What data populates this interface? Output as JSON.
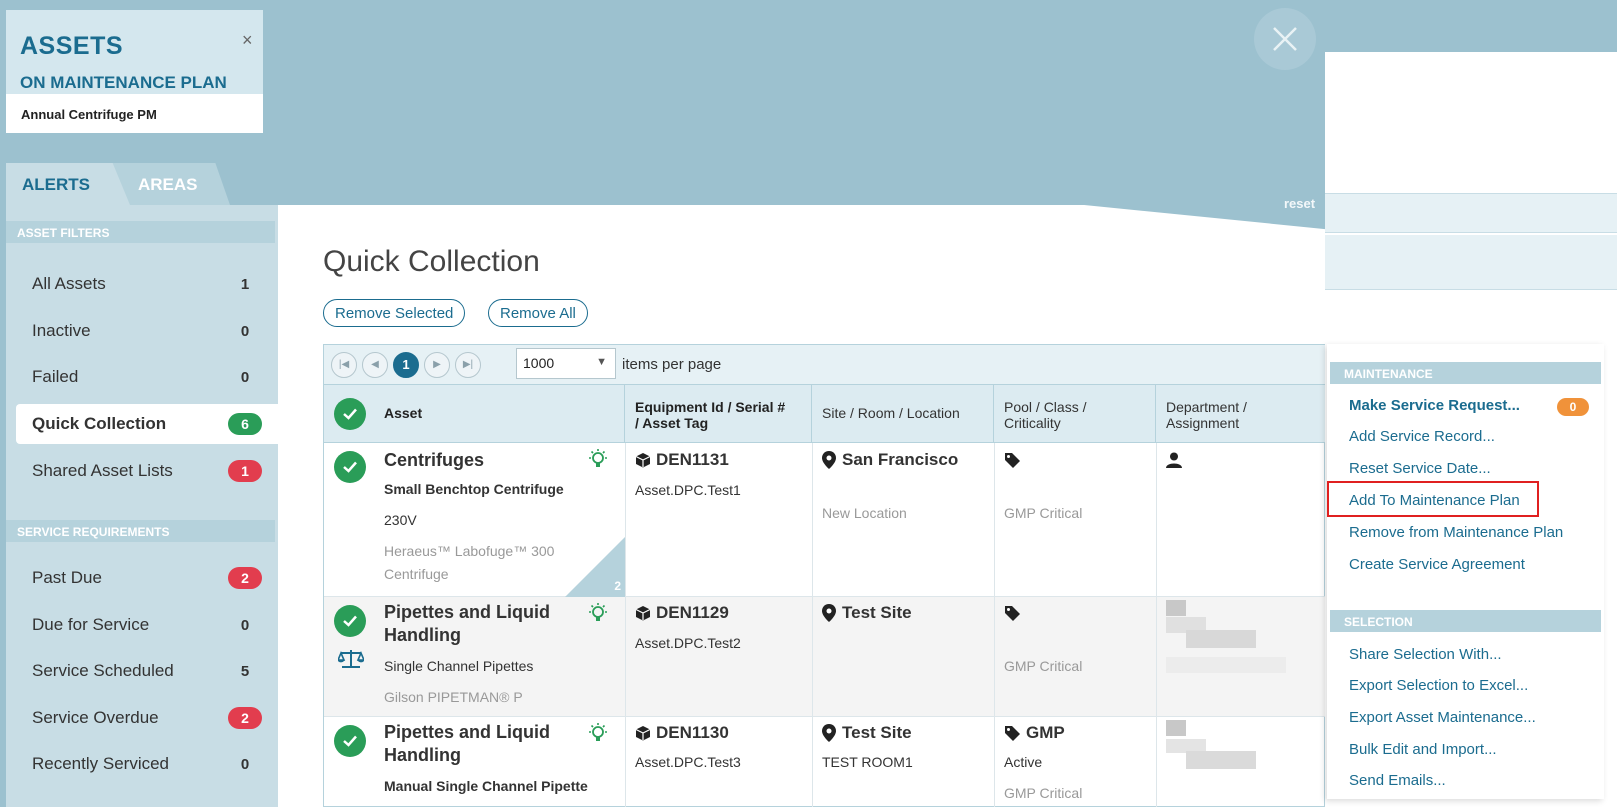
{
  "header": {
    "title": "ASSETS",
    "subtitle": "ON MAINTENANCE PLAN",
    "plan_name": "Annual Centrifuge PM",
    "close_glyph": "×"
  },
  "tabs": [
    {
      "label": "ALERTS",
      "active": true
    },
    {
      "label": "AREAS",
      "active": false
    }
  ],
  "reset_label": "reset",
  "sidebar": {
    "asset_filters_heading": "ASSET FILTERS",
    "asset_filters": [
      {
        "label": "All Assets",
        "count": "1"
      },
      {
        "label": "Inactive",
        "count": "0"
      },
      {
        "label": "Failed",
        "count": "0"
      },
      {
        "label": "Quick Collection",
        "count": "6",
        "active": true
      },
      {
        "label": "Shared Asset Lists",
        "count": "1"
      }
    ],
    "service_heading": "SERVICE REQUIREMENTS",
    "service_filters": [
      {
        "label": "Past Due",
        "count": "2"
      },
      {
        "label": "Due for Service",
        "count": "0"
      },
      {
        "label": "Service Scheduled",
        "count": "5"
      },
      {
        "label": "Service Overdue",
        "count": "2"
      },
      {
        "label": "Recently Serviced",
        "count": "0"
      }
    ]
  },
  "main": {
    "title": "Quick Collection",
    "remove_selected": "Remove Selected",
    "remove_all": "Remove All",
    "pager": {
      "current_page": "1",
      "per_page": "1000",
      "per_page_label": "items per page"
    },
    "columns": {
      "asset": "Asset",
      "equipment_a": "Equipment Id",
      "equipment_b": "/ Serial #",
      "equipment_c": "/ Asset Tag",
      "site": "Site / Room / Location",
      "pool_a": "Pool / Class /",
      "pool_b": "Criticality",
      "dept_a": "Department /",
      "dept_b": "Assignment"
    },
    "rows": [
      {
        "category": "Centrifuges",
        "model": "Small Benchtop Centrifuge",
        "detail": "230V",
        "manufacturer_a": "Heraeus™ Labofuge™ 300",
        "manufacturer_b": "Centrifuge",
        "badge_count": "2",
        "equipment_id": "DEN1131",
        "serial": "Asset.DPC.Test1",
        "site": "San Francisco",
        "location": "New Location",
        "pool": "",
        "criticality": "GMP Critical"
      },
      {
        "category_a": "Pipettes and Liquid",
        "category_b": "Handling",
        "model": "Single Channel Pipettes",
        "manufacturer": "Gilson PIPETMAN® P",
        "equipment_id": "DEN1129",
        "serial": "Asset.DPC.Test2",
        "site": "Test Site",
        "pool": "",
        "criticality": "GMP Critical"
      },
      {
        "category_a": "Pipettes and Liquid",
        "category_b": "Handling",
        "model": "Manual Single Channel Pipette",
        "equipment_id": "DEN1130",
        "serial": "Asset.DPC.Test3",
        "site": "Test Site",
        "room": "TEST ROOM1",
        "pool": "GMP",
        "class": "Active",
        "criticality": "GMP Critical"
      }
    ]
  },
  "context_menu": {
    "maintenance_heading": "MAINTENANCE",
    "make_service_request": "Make Service Request...",
    "service_request_count": "0",
    "add_service_record": "Add Service Record...",
    "reset_service_date": "Reset Service Date...",
    "add_to_plan": "Add To Maintenance Plan",
    "remove_from_plan": "Remove from Maintenance Plan",
    "create_agreement": "Create Service Agreement",
    "selection_heading": "SELECTION",
    "share_selection": "Share Selection With...",
    "export_excel": "Export Selection to Excel...",
    "export_maintenance": "Export Asset Maintenance...",
    "bulk_edit": "Bulk Edit and Import...",
    "send_emails": "Send Emails..."
  },
  "colors": {
    "accent": "#1b6c8f",
    "header_bg": "#9cc1cf",
    "success": "#2a9d58",
    "danger": "#e23d4e",
    "warning": "#f0923a"
  }
}
